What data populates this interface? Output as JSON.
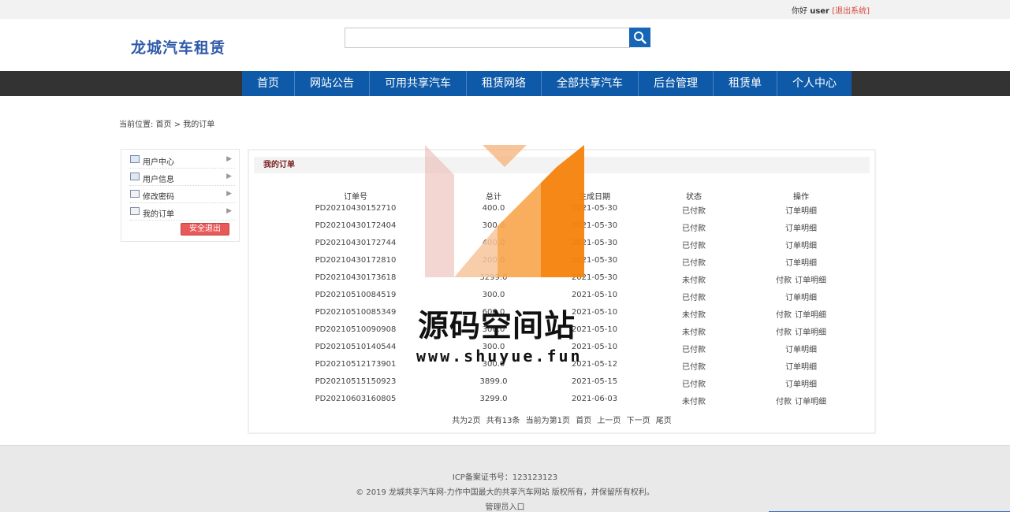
{
  "topbar": {
    "greeting": "你好",
    "username": "user",
    "logout_link": "[退出系统]"
  },
  "header": {
    "logo": "龙城汽车租赁",
    "search": {
      "value": "",
      "placeholder": ""
    },
    "search_icon": "magnifier-icon"
  },
  "nav": {
    "items": [
      "首页",
      "网站公告",
      "可用共享汽车",
      "租赁网络",
      "全部共享汽车",
      "后台管理",
      "租赁单",
      "个人中心"
    ]
  },
  "breadcrumb": {
    "text": "当前位置: 首页 > 我的订单"
  },
  "sidebar": {
    "items": [
      "用户中心",
      "用户信息",
      "修改密码",
      "我的订单"
    ],
    "logout_button": "安全退出"
  },
  "orders": {
    "title": "我的订单",
    "columns": [
      "订单号",
      "总计",
      "生成日期",
      "状态",
      "操作"
    ],
    "rows": [
      {
        "id": "PD20210430152710",
        "total": "400.0",
        "date": "2021-05-30",
        "status": "已付款",
        "pay": "",
        "detail": "订单明细"
      },
      {
        "id": "PD20210430172404",
        "total": "300.0",
        "date": "2021-05-30",
        "status": "已付款",
        "pay": "",
        "detail": "订单明细"
      },
      {
        "id": "PD20210430172744",
        "total": "400.0",
        "date": "2021-05-30",
        "status": "已付款",
        "pay": "",
        "detail": "订单明细"
      },
      {
        "id": "PD20210430172810",
        "total": "200.0",
        "date": "2021-05-30",
        "status": "已付款",
        "pay": "",
        "detail": "订单明细"
      },
      {
        "id": "PD20210430173618",
        "total": "3299.0",
        "date": "2021-05-30",
        "status": "未付款",
        "pay": "付款",
        "detail": "订单明细"
      },
      {
        "id": "PD20210510084519",
        "total": "300.0",
        "date": "2021-05-10",
        "status": "已付款",
        "pay": "",
        "detail": "订单明细"
      },
      {
        "id": "PD20210510085349",
        "total": "600.0",
        "date": "2021-05-10",
        "status": "未付款",
        "pay": "付款",
        "detail": "订单明细"
      },
      {
        "id": "PD20210510090908",
        "total": "300.0",
        "date": "2021-05-10",
        "status": "未付款",
        "pay": "付款",
        "detail": "订单明细"
      },
      {
        "id": "PD20210510140544",
        "total": "300.0",
        "date": "2021-05-10",
        "status": "已付款",
        "pay": "",
        "detail": "订单明细"
      },
      {
        "id": "PD20210512173901",
        "total": "300.0",
        "date": "2021-05-12",
        "status": "已付款",
        "pay": "",
        "detail": "订单明细"
      },
      {
        "id": "PD20210515150923",
        "total": "3899.0",
        "date": "2021-05-15",
        "status": "已付款",
        "pay": "",
        "detail": "订单明细"
      },
      {
        "id": "PD20210603160805",
        "total": "3299.0",
        "date": "2021-06-03",
        "status": "未付款",
        "pay": "付款",
        "detail": "订单明细"
      }
    ],
    "pager": {
      "pages": "共为2页",
      "records": "共有13条",
      "current": "当前为第1页",
      "first": "首页",
      "prev": "上一页",
      "next": "下一页",
      "last": "尾页"
    }
  },
  "watermark": {
    "text": "源码空间站",
    "url": "www.shuyue.fun"
  },
  "footer": {
    "icp": "ICP备案证书号：123123123",
    "copyright": "© 2019 龙城共享汽车网-力作中国最大的共享汽车网站 版权所有，并保留所有权利。",
    "admin_link": "管理员入口"
  },
  "colors": {
    "nav_blue": "#0f5aa8",
    "nav_bar": "#333333",
    "logo": "#2f5aa8",
    "logout_red": "#e8595a",
    "watermark_orange": "#f5820b"
  }
}
